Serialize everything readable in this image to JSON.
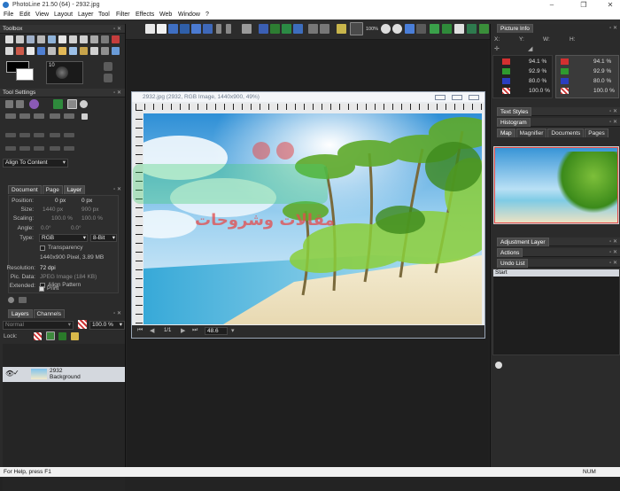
{
  "window": {
    "title": "PhotoLine 21.50 (64) - 2932.jpg"
  },
  "menu": [
    "File",
    "Edit",
    "View",
    "Layout",
    "Layer",
    "Tool",
    "Filter",
    "Effects",
    "Web",
    "Window",
    "?"
  ],
  "toolbar": {
    "zoom_label": "100%"
  },
  "toolbox": {
    "title": "Toolbox",
    "brush_size": "10"
  },
  "tool_settings": {
    "title": "Tool Settings",
    "align_select": "Align To Content"
  },
  "doc_panel": {
    "tabs": [
      "Document",
      "Page",
      "Layer"
    ],
    "active_tab": "Layer",
    "position_label": "Position:",
    "position_x": "0 px",
    "position_y": "0 px",
    "size_label": "Size:",
    "size_w": "1440 px",
    "size_h": "900 px",
    "scaling_label": "Scaling:",
    "scaling_x": "100.0 %",
    "scaling_y": "100.0 %",
    "angle_label": "Angle:",
    "angle_a": "0.0°",
    "angle_b": "0.0°",
    "type_label": "Type:",
    "type_value": "RGB",
    "bit_value": "8-Bit",
    "transparency_label": "Transparency",
    "pixel_info": "1440x900 Pixel, 3.89 MB",
    "resolution_label": "Resolution:",
    "resolution_value": "72 dpi",
    "picdata_label": "Pic. Data:",
    "picdata_value": "JPEG Image (184 KB)",
    "extended_label": "Extended:",
    "align_pattern_label": "Align Pattern",
    "print_label": "Print"
  },
  "layers_panel": {
    "tabs": [
      "Layers",
      "Channels"
    ],
    "blend_mode": "Normal",
    "opacity": "100.0 %",
    "lock_label": "Lock:",
    "layer_name": "2932",
    "layer_sub": "Background"
  },
  "document": {
    "title": "2932.jpg (2932, RGB Image, 1440x900, 49%)",
    "page_indicator": "1/1",
    "zoom_value": "48.6"
  },
  "picture_info": {
    "title": "Picture Info",
    "coord_labels": [
      "X:",
      "Y:",
      "W:",
      "H:"
    ],
    "left_values": [
      "94.1 %",
      "92.9 %",
      "80.0 %",
      "100.0 %"
    ],
    "right_values": [
      "94.1 %",
      "92.9 %",
      "80.0 %",
      "100.0 %"
    ]
  },
  "right_panels": {
    "text_styles": "Text Styles",
    "histogram": "Histogram",
    "nav_tabs": [
      "Map",
      "Magnifier",
      "Documents",
      "Pages"
    ],
    "adjustment_layer": "Adjustment Layer",
    "actions": "Actions",
    "undo_list": "Undo List",
    "undo_item": "Start"
  },
  "statusbar": {
    "help": "For Help, press F1",
    "num": "NUM"
  },
  "watermark": {
    "text": "مقالات وشروحات"
  },
  "colors": {
    "accent_blue": "#2b76c7",
    "watermark_red": "#e54b4b",
    "watermark_green": "#3ecf6f",
    "selection": "#cfd5df"
  }
}
